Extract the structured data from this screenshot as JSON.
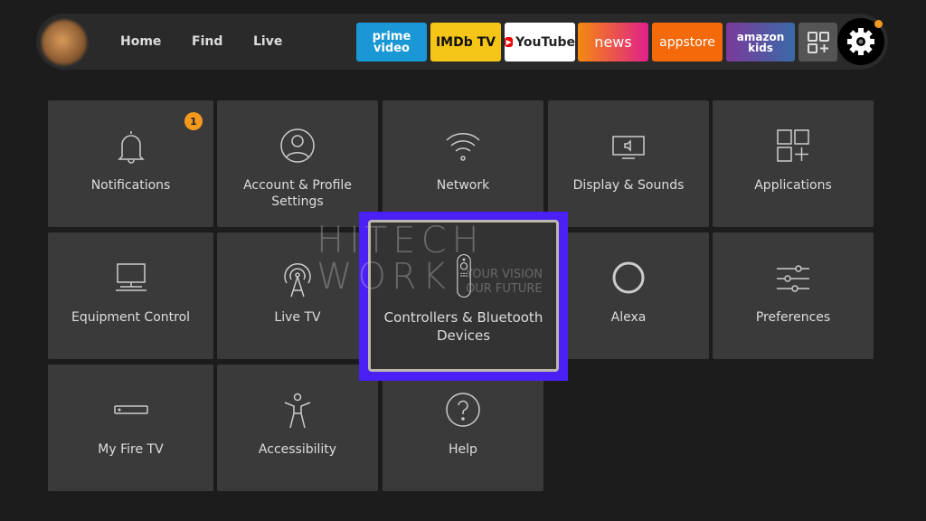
{
  "nav": {
    "items": [
      {
        "label": "Home"
      },
      {
        "label": "Find"
      },
      {
        "label": "Live"
      }
    ]
  },
  "apps": [
    {
      "label": "prime video",
      "color": "#1a98d5"
    },
    {
      "label": "IMDb TV",
      "color": "#f5c518"
    },
    {
      "label": "YouTube",
      "color": "#ffffff"
    },
    {
      "label": "news",
      "color": "#f26b1d"
    },
    {
      "label": "appstore",
      "color": "#f46a0a"
    },
    {
      "label": "amazon kids",
      "color": "#6a4aa8"
    }
  ],
  "settings": {
    "tiles": [
      {
        "label": "Notifications",
        "icon": "bell-icon",
        "badge": "1"
      },
      {
        "label": "Account & Profile Settings",
        "icon": "user-icon"
      },
      {
        "label": "Network",
        "icon": "wifi-icon"
      },
      {
        "label": "Display & Sounds",
        "icon": "display-icon"
      },
      {
        "label": "Applications",
        "icon": "apps-icon"
      },
      {
        "label": "Equipment Control",
        "icon": "monitor-icon"
      },
      {
        "label": "Live TV",
        "icon": "antenna-icon"
      },
      {
        "label": "Controllers & Bluetooth Devices",
        "icon": "remote-icon",
        "focused": true
      },
      {
        "label": "Alexa",
        "icon": "alexa-icon"
      },
      {
        "label": "Preferences",
        "icon": "sliders-icon"
      },
      {
        "label": "My Fire TV",
        "icon": "firetv-stick-icon"
      },
      {
        "label": "Accessibility",
        "icon": "accessibility-icon"
      },
      {
        "label": "Help",
        "icon": "help-icon"
      }
    ]
  },
  "watermark": {
    "title": "HITECH WORK",
    "tagline1": "YOUR VISION",
    "tagline2": "OUR FUTURE"
  },
  "colors": {
    "focus": "#4a20f5",
    "badge": "#f39a1e",
    "tile": "#3a3a3a"
  }
}
